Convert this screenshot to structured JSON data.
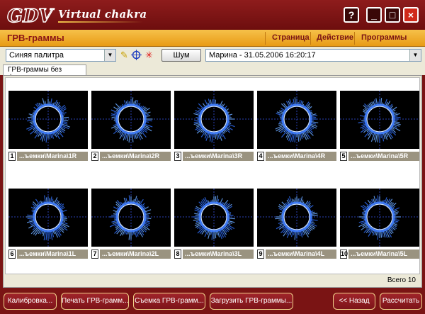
{
  "window": {
    "app_title": "Virtual chakra",
    "logo_text": "GDV",
    "buttons": {
      "help": "?",
      "minimize": "_",
      "maximize": "□",
      "close": "×"
    }
  },
  "menubar": {
    "section_title": "ГРВ-граммы",
    "items": [
      "Страница",
      "Действие",
      "Программы"
    ]
  },
  "toolbar": {
    "palette_value": "Синяя палитра",
    "noise_label": "Шум",
    "session_value": "Марина - 31.05.2006 16:20:17",
    "icons": [
      "wand-icon",
      "crosshair-icon",
      "star-icon"
    ]
  },
  "tabs": [
    {
      "label": "ГРВ-граммы без фильтра"
    }
  ],
  "thumbnails": [
    {
      "num": "1",
      "path": "...ъемки\\Marina\\1R"
    },
    {
      "num": "2",
      "path": "...ъемки\\Marina\\2R"
    },
    {
      "num": "3",
      "path": "...ъемки\\Marina\\3R"
    },
    {
      "num": "4",
      "path": "...ъемки\\Marina\\4R"
    },
    {
      "num": "5",
      "path": "...ъемки\\Marina\\5R"
    },
    {
      "num": "6",
      "path": "...ъемки\\Marina\\1L"
    },
    {
      "num": "7",
      "path": "...ъемки\\Marina\\2L"
    },
    {
      "num": "8",
      "path": "...ъемки\\Marina\\3L"
    },
    {
      "num": "9",
      "path": "...ъемки\\Marina\\4L"
    },
    {
      "num": "10",
      "path": "...ъемки\\Marina\\5L"
    }
  ],
  "status": {
    "total_label": "Всего",
    "total": "10"
  },
  "bottom_buttons": {
    "calibration": "Калибровка...",
    "print": "Печать ГРВ-грамм...",
    "capture": "Съемка ГРВ-грамм...",
    "load": "Загрузить ГРВ-граммы...",
    "back": "<< Назад",
    "calculate": "Рассчитать"
  },
  "colors": {
    "window_red": "#7a1414",
    "menu_orange": "#f0ac2b",
    "glow_blue": "#4a8cff",
    "caption_bg": "#9a9380"
  }
}
